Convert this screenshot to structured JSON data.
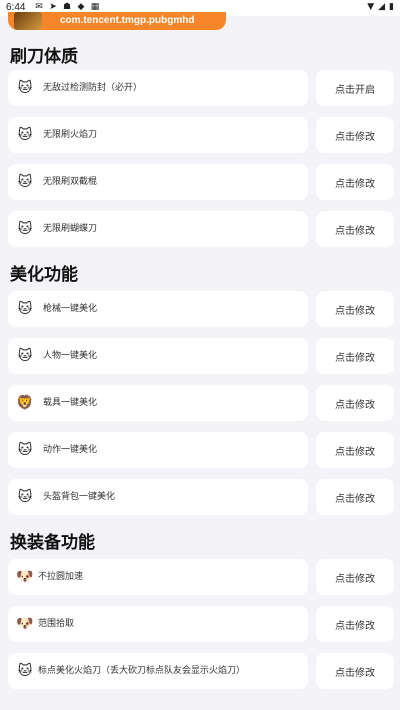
{
  "status_bar": {
    "time": "6:44",
    "left_icons": [
      "mail-icon",
      "send-icon",
      "android-icon",
      "shield-icon",
      "keyboard-icon"
    ],
    "right_icons": [
      "wifi-icon",
      "signal-icon",
      "battery-icon"
    ]
  },
  "banner": {
    "package": "com.tencent.tmgp.pubgmhd"
  },
  "sections": [
    {
      "title": "刷刀体质",
      "rows": [
        {
          "label": "无敌过检测防封（必开）",
          "button": "点击开启",
          "icon": "cat-icon"
        },
        {
          "label": "无限刷火焰刀",
          "button": "点击修改",
          "icon": "cat-icon"
        },
        {
          "label": "无限刷双截棍",
          "button": "点击修改",
          "icon": "cat-icon"
        },
        {
          "label": "无限刷蝴蝶刀",
          "button": "点击修改",
          "icon": "cat-icon"
        }
      ]
    },
    {
      "title": "美化功能",
      "rows": [
        {
          "label": "枪械一键美化",
          "button": "点击修改",
          "icon": "cat-icon"
        },
        {
          "label": "人物一键美化",
          "button": "点击修改",
          "icon": "cat-icon"
        },
        {
          "label": "载具一键美化",
          "button": "点击修改",
          "icon": "lion-icon"
        },
        {
          "label": "动作一键美化",
          "button": "点击修改",
          "icon": "cat-icon"
        },
        {
          "label": "头盔背包一键美化",
          "button": "点击修改",
          "icon": "cat-icon"
        }
      ]
    },
    {
      "title": "换装备功能",
      "rows": [
        {
          "label": "不拉圆加速",
          "button": "点击修改",
          "icon": "dog-icon"
        },
        {
          "label": "范围拾取",
          "button": "点击修改",
          "icon": "dog-icon"
        },
        {
          "label": "标点美化火焰刀（丢大砍刀标点队友会显示火焰刀）",
          "button": "点击修改",
          "icon": "cat-icon"
        }
      ]
    }
  ]
}
